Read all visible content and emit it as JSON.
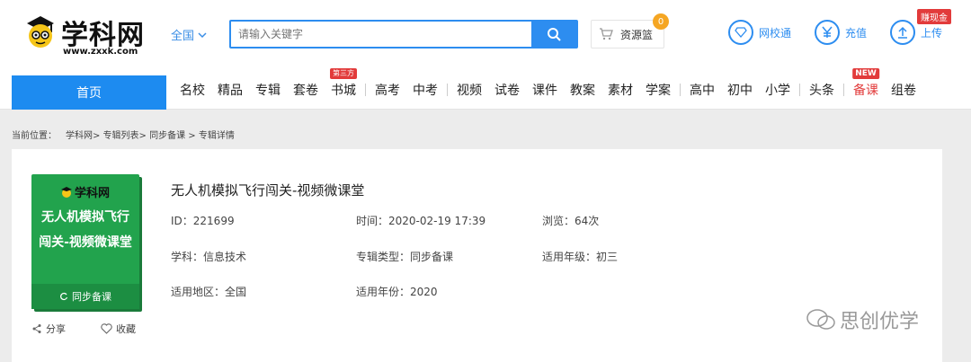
{
  "header": {
    "brand": "学科网",
    "url": "www.zxxk.com",
    "region": "全国",
    "search_placeholder": "请输入关键字",
    "basket_label": "资源篮",
    "basket_count": "0",
    "actions": [
      "网校通",
      "充值",
      "上传"
    ],
    "earn_badge": "赚现金"
  },
  "nav": {
    "home": "首页",
    "items": [
      "名校",
      "精品",
      "专辑",
      "套卷",
      "书城",
      "高考",
      "中考",
      "视频",
      "试卷",
      "课件",
      "教案",
      "素材",
      "学案",
      "高中",
      "初中",
      "小学",
      "头条",
      "备课",
      "组卷"
    ],
    "tag_third_party": "第三方",
    "tag_new": "NEW"
  },
  "breadcrumb": {
    "prefix": "当前位置：",
    "path": "学科网> 专辑列表> 同步备课 > 专辑详情"
  },
  "detail": {
    "cover": {
      "logo": "学科网",
      "title": "无人机模拟飞行闯关-视频微课堂",
      "bar": "同步备课"
    },
    "title": "无人机模拟飞行闯关-视频微课堂",
    "id": "ID：221699",
    "time": "时间：2020-02-19 17:39",
    "views": "浏览：64次",
    "subject": "学科：信息技术",
    "album_type": "专辑类型：同步备课",
    "grade": "适用年级：初三",
    "area": "适用地区：全国",
    "year": "适用年份：2020",
    "share": "分享",
    "favorite": "收藏"
  },
  "watermark": "思创优学",
  "colors": {
    "accent": "#2d8df0",
    "cover_green": "#22a34d",
    "red": "#e23b3b",
    "orange": "#f5a623"
  }
}
